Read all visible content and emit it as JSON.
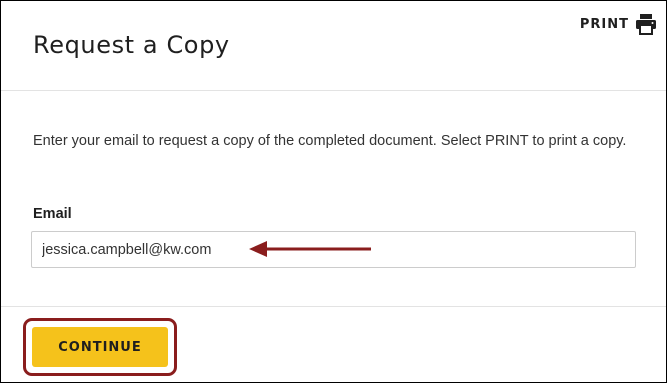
{
  "dialog": {
    "title": "Request a Copy",
    "print_label": "PRINT",
    "print_icon": "printer-icon",
    "instructions": "Enter your email to request a copy of the completed document. Select PRINT to print a copy.",
    "email": {
      "label": "Email",
      "value": "jessica.campbell@kw.com"
    },
    "continue_label": "CONTINUE"
  },
  "annotations": {
    "arrow_icon": "arrow-left-icon",
    "highlight_icon": "highlight-box"
  },
  "colors": {
    "accent_button": "#f5c21b",
    "annotation": "#8a1d1d",
    "text": "#1f1f1f",
    "divider": "#e3e3e3",
    "frame_border": "#000000"
  }
}
